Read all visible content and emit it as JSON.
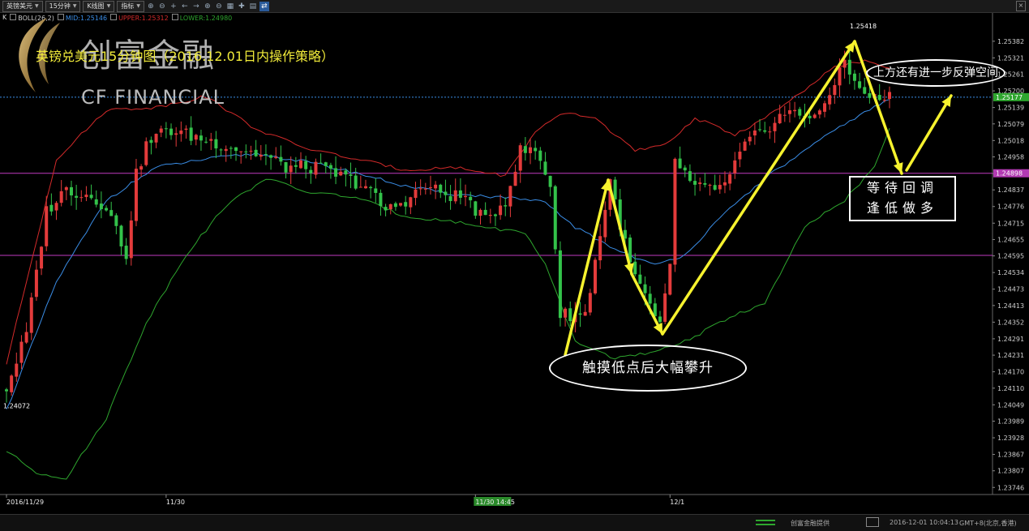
{
  "toolbar": {
    "symbol": "英镑美元",
    "period": "15分钟",
    "chart_type": "K线图",
    "indicator": "指标",
    "icons": [
      "zoom-in-icon",
      "zoom-out-icon",
      "plus-icon",
      "arrow-left-icon",
      "arrow-right-icon",
      "zoom-in-icon",
      "zoom-out-icon",
      "grid-icon",
      "settings-icon",
      "chart-icon",
      "link-icon"
    ]
  },
  "indicator_bar": {
    "label": "K",
    "name": "BOLL(26,2)",
    "mid": "MID:1.25146",
    "upper": "UPPER:1.25312",
    "lower": "LOWER:1.24980"
  },
  "logo": {
    "cn": "创富金融",
    "en": "CF FINANCIAL"
  },
  "title": "英镑兑美元15分钟图（2016.12.01日内操作策略）",
  "annotations": {
    "top_right": "上方还有进一步反弹空间",
    "wait_line1": "等待回调",
    "wait_line2": "逢低做多",
    "bottom": "触摸低点后大幅攀升"
  },
  "statusbar": {
    "provider": "创富金融提供",
    "datetime": "2016-12-01 10:04:13",
    "timezone": "GMT+8(北京,香港)"
  },
  "colors": {
    "up": "#e33b3b",
    "down": "#33c24a",
    "upper": "#d42a2a",
    "mid": "#3a8de6",
    "lower": "#2ea62e",
    "hline": "#c03ac0",
    "arrow": "#f6f22e",
    "price_tag": "#2ea62e"
  },
  "chart_data": {
    "type": "candlestick",
    "ylim": [
      1.2372,
      1.2545
    ],
    "y_ticks": [
      "1.25382",
      "1.25321",
      "1.25261",
      "1.25200",
      "1.25139",
      "1.25079",
      "1.25018",
      "1.24958",
      "1.24897",
      "1.24837",
      "1.24776",
      "1.24715",
      "1.24655",
      "1.24595",
      "1.24534",
      "1.24473",
      "1.24413",
      "1.24352",
      "1.24291",
      "1.24231",
      "1.24170",
      "1.24110",
      "1.24049",
      "1.23989",
      "1.23928",
      "1.23867",
      "1.23807",
      "1.23746"
    ],
    "x_labels": [
      {
        "label": "2016/11/29",
        "index": 0
      },
      {
        "label": "11/30",
        "index": 32
      },
      {
        "label": "11/30 14:45",
        "index": 94
      },
      {
        "label": "12/1",
        "index": 133
      }
    ],
    "high_label": "1.25418",
    "low_label": "1.24072",
    "current_price": "1.25177",
    "hline_price": "1.24898",
    "hline_prices": [
      1.24898,
      1.24597
    ],
    "count": 178,
    "anchors": [
      [
        0,
        1.2411
      ],
      [
        4,
        1.2431
      ],
      [
        8,
        1.2476
      ],
      [
        12,
        1.2484
      ],
      [
        16,
        1.2482
      ],
      [
        20,
        1.2478
      ],
      [
        24,
        1.246
      ],
      [
        26,
        1.2489
      ],
      [
        28,
        1.25
      ],
      [
        32,
        1.2506
      ],
      [
        40,
        1.2502
      ],
      [
        48,
        1.2498
      ],
      [
        52,
        1.2496
      ],
      [
        56,
        1.2492
      ],
      [
        62,
        1.2492
      ],
      [
        68,
        1.2488
      ],
      [
        72,
        1.2485
      ],
      [
        76,
        1.2476
      ],
      [
        80,
        1.248
      ],
      [
        84,
        1.2485
      ],
      [
        88,
        1.2482
      ],
      [
        92,
        1.2481
      ],
      [
        96,
        1.2472
      ],
      [
        100,
        1.248
      ],
      [
        103,
        1.2498
      ],
      [
        106,
        1.2498
      ],
      [
        109,
        1.2486
      ],
      [
        111,
        1.2438
      ],
      [
        116,
        1.2438
      ],
      [
        121,
        1.2487
      ],
      [
        125,
        1.2456
      ],
      [
        131,
        1.2433
      ],
      [
        133,
        1.2455
      ],
      [
        134,
        1.2495
      ],
      [
        138,
        1.2484
      ],
      [
        144,
        1.2485
      ],
      [
        148,
        1.25
      ],
      [
        152,
        1.2506
      ],
      [
        156,
        1.2512
      ],
      [
        160,
        1.2511
      ],
      [
        164,
        1.2513
      ],
      [
        168,
        1.2533
      ],
      [
        170,
        1.2522
      ],
      [
        174,
        1.2517
      ],
      [
        177,
        1.25177
      ]
    ],
    "upper_anchors": [
      [
        0,
        1.242
      ],
      [
        10,
        1.2495
      ],
      [
        20,
        1.2513
      ],
      [
        30,
        1.2514
      ],
      [
        40,
        1.2518
      ],
      [
        50,
        1.2506
      ],
      [
        60,
        1.2499
      ],
      [
        70,
        1.2495
      ],
      [
        80,
        1.2491
      ],
      [
        90,
        1.2492
      ],
      [
        96,
        1.249
      ],
      [
        100,
        1.2489
      ],
      [
        106,
        1.2505
      ],
      [
        112,
        1.2512
      ],
      [
        118,
        1.251
      ],
      [
        126,
        1.2498
      ],
      [
        132,
        1.25
      ],
      [
        138,
        1.251
      ],
      [
        146,
        1.2504
      ],
      [
        152,
        1.251
      ],
      [
        160,
        1.252
      ],
      [
        166,
        1.2529
      ],
      [
        172,
        1.2531
      ],
      [
        177,
        1.2528
      ]
    ],
    "mid_anchors": [
      [
        0,
        1.2403
      ],
      [
        10,
        1.245
      ],
      [
        20,
        1.248
      ],
      [
        30,
        1.2492
      ],
      [
        40,
        1.2495
      ],
      [
        50,
        1.2497
      ],
      [
        60,
        1.2494
      ],
      [
        70,
        1.249
      ],
      [
        80,
        1.2485
      ],
      [
        90,
        1.2482
      ],
      [
        100,
        1.2481
      ],
      [
        108,
        1.2479
      ],
      [
        114,
        1.247
      ],
      [
        122,
        1.2462
      ],
      [
        130,
        1.2456
      ],
      [
        136,
        1.246
      ],
      [
        144,
        1.2475
      ],
      [
        152,
        1.2488
      ],
      [
        160,
        1.2498
      ],
      [
        168,
        1.2508
      ],
      [
        172,
        1.2512
      ],
      [
        177,
        1.2517
      ]
    ],
    "lower_anchors": [
      [
        0,
        1.2388
      ],
      [
        6,
        1.238
      ],
      [
        12,
        1.2378
      ],
      [
        20,
        1.24
      ],
      [
        28,
        1.2435
      ],
      [
        36,
        1.246
      ],
      [
        44,
        1.2478
      ],
      [
        52,
        1.2488
      ],
      [
        60,
        1.2483
      ],
      [
        70,
        1.2481
      ],
      [
        80,
        1.2474
      ],
      [
        90,
        1.2472
      ],
      [
        96,
        1.247
      ],
      [
        104,
        1.2468
      ],
      [
        108,
        1.2456
      ],
      [
        114,
        1.2428
      ],
      [
        122,
        1.2422
      ],
      [
        130,
        1.2424
      ],
      [
        138,
        1.243
      ],
      [
        146,
        1.2438
      ],
      [
        152,
        1.2442
      ],
      [
        160,
        1.247
      ],
      [
        168,
        1.248
      ],
      [
        174,
        1.2492
      ],
      [
        177,
        1.2506
      ]
    ]
  }
}
